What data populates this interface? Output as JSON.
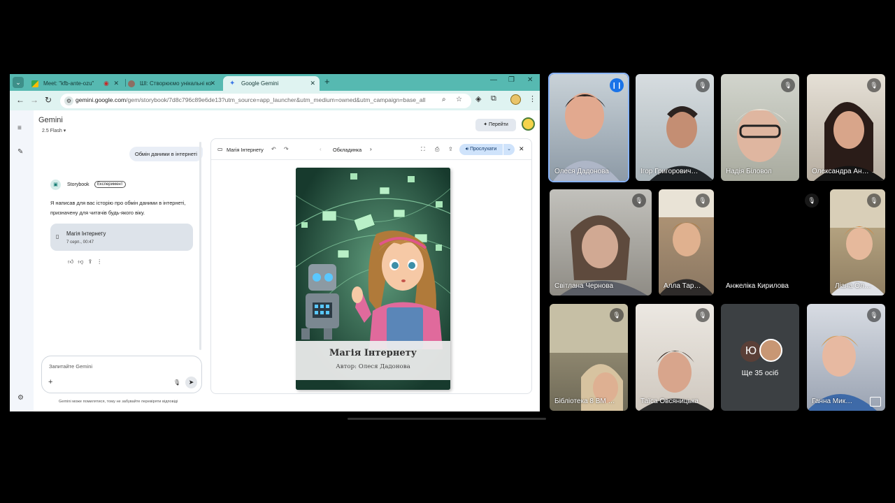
{
  "browser": {
    "tabs": [
      {
        "label": "Meet: \"kfb-ante-ozu\""
      },
      {
        "label": "ШІ: Створюємо унікальні ко"
      },
      {
        "label": "Google Gemini"
      }
    ],
    "url_domain": "gemini.google.com",
    "url_path": "/gem/storybook/7d8c796c89e6de13?utm_source=app_launcher&utm_medium=owned&utm_campaign=base_all"
  },
  "gemini": {
    "brand": "Gemini",
    "model": "2.5 Flash",
    "go_button": "Перейти",
    "user_message": "Обмін даними в інтернеті",
    "gem_name": "Storybook",
    "gem_badge": "Експеримент",
    "reply_line1": "Я написав для вас історію про обмін даними в інтернеті,",
    "reply_line2": "призначену для читачів будь-якого віку.",
    "story_card_title": "Магія Інтернету",
    "story_card_date": "7 серп., 00:47",
    "input_placeholder": "Запитайте Gemini",
    "disclaimer": "Gemini може помилятися, тому не забувайте перевіряти відповіді"
  },
  "reader": {
    "title": "Магія Інтернету",
    "page_label": "Обкладинка",
    "listen_button": "Прослухати",
    "book_title": "Магія Інтернету",
    "book_author": "Автор: Олеся Дадонова"
  },
  "meet": {
    "participants": [
      {
        "name": "Олеся Дадонова"
      },
      {
        "name": "Ігор Григорович…"
      },
      {
        "name": "Надія Біловол"
      },
      {
        "name": "Олександра Ан…"
      },
      {
        "name": "Світлана Чернова"
      },
      {
        "name": "Алла Тар…"
      },
      {
        "name": "Анжеліка Кирилова"
      },
      {
        "name": "Ліана Ол…"
      },
      {
        "name": "Бібліотека 8 ВМ …"
      },
      {
        "name": "Таїса Овсяницька"
      },
      {
        "name": "Ганна Мик…"
      }
    ],
    "more_initial": "Ю",
    "more_label": "Ще 35 осіб"
  }
}
